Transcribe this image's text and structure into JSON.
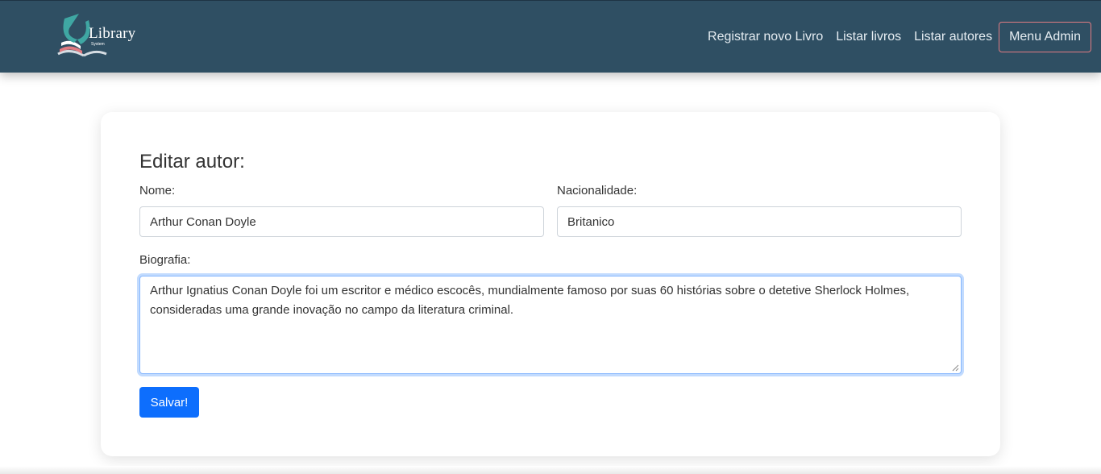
{
  "header": {
    "brand": {
      "title": "Library",
      "subtitle": "System",
      "icon": "book-logo-icon"
    },
    "nav": [
      {
        "label": "Registrar novo Livro"
      },
      {
        "label": "Listar livros"
      },
      {
        "label": "Listar autores"
      }
    ],
    "admin_label": "Menu Admin",
    "colors": {
      "background": "#2f4f63",
      "admin_border": "#e07b82"
    }
  },
  "form": {
    "title": "Editar autor:",
    "nome": {
      "label": "Nome:",
      "value": "Arthur Conan Doyle"
    },
    "nacionalidade": {
      "label": "Nacionalidade:",
      "value": "Britanico"
    },
    "biografia": {
      "label": "Biografia:",
      "value": "Arthur Ignatius Conan Doyle foi um escritor e médico escocês, mundialmente famoso por suas 60 histórias sobre o detetive Sherlock Holmes, consideradas uma grande inovação no campo da literatura criminal."
    },
    "save_label": "Salvar!",
    "colors": {
      "primary": "#0d6efd",
      "focus_border": "#86b7fe"
    }
  }
}
